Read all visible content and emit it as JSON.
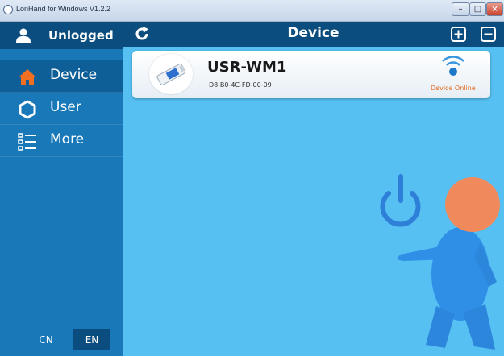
{
  "window": {
    "title": "LonHand for Windows V1.2.2"
  },
  "sidebar": {
    "user_label": "Unlogged",
    "items": [
      {
        "label": "Device",
        "icon": "home-icon",
        "active": true
      },
      {
        "label": "User",
        "icon": "gear-icon",
        "active": false
      },
      {
        "label": "More",
        "icon": "list-icon",
        "active": false
      }
    ],
    "languages": [
      "CN",
      "EN"
    ],
    "selected_language": "EN"
  },
  "main": {
    "title": "Device",
    "devices": [
      {
        "name": "USR-WM1",
        "mac": "D8-B0-4C-FD-00-09",
        "status": "Device Online"
      }
    ]
  },
  "colors": {
    "sidebar_bg": "#1878b8",
    "header_bg": "#0b4d7e",
    "main_bg": "#57c0f2",
    "status_online": "#e56a1f",
    "mascot": "#2f8fe6",
    "mascot_head": "#f08a5d"
  }
}
